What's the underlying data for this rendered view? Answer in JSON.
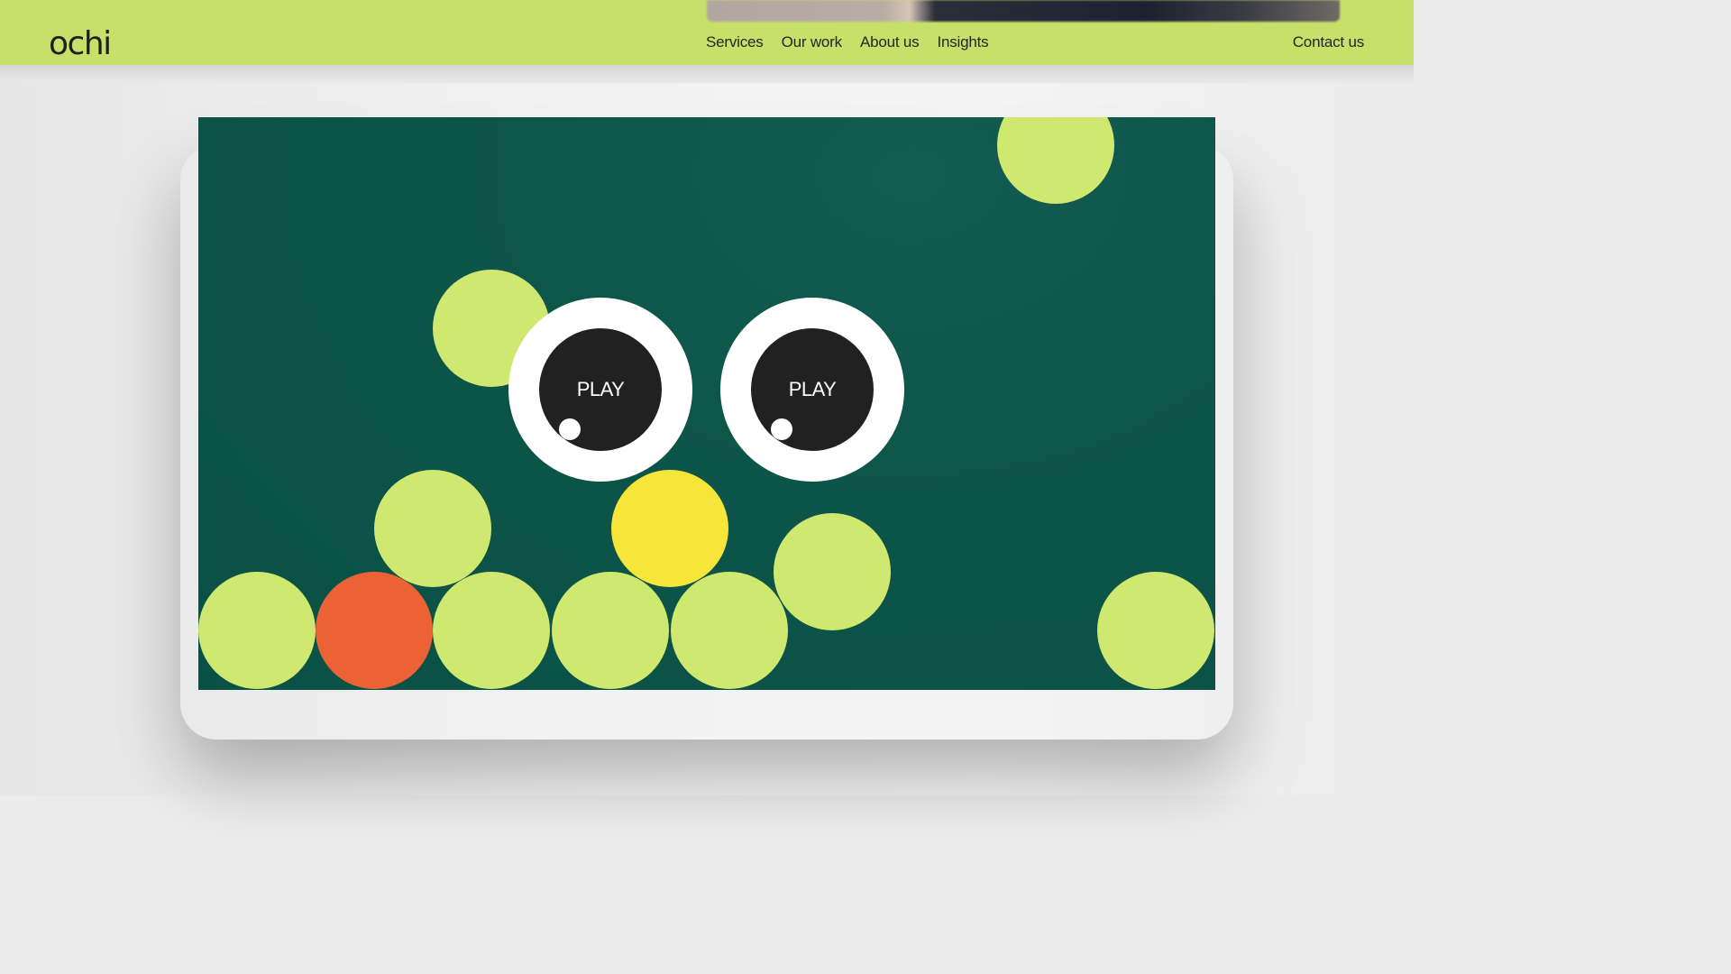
{
  "header": {
    "logo": "ochi",
    "nav": [
      "Services",
      "Our work",
      "About us",
      "Insights"
    ],
    "contact": "Contact us",
    "background": "#c6e06a"
  },
  "game": {
    "background": "#0c5347",
    "eyes": [
      {
        "label": "PLAY"
      },
      {
        "label": "PLAY"
      }
    ],
    "ball_colors": {
      "lime": "#cfe870",
      "orange": "#ec6235",
      "yellow": "#f6e63a"
    }
  }
}
